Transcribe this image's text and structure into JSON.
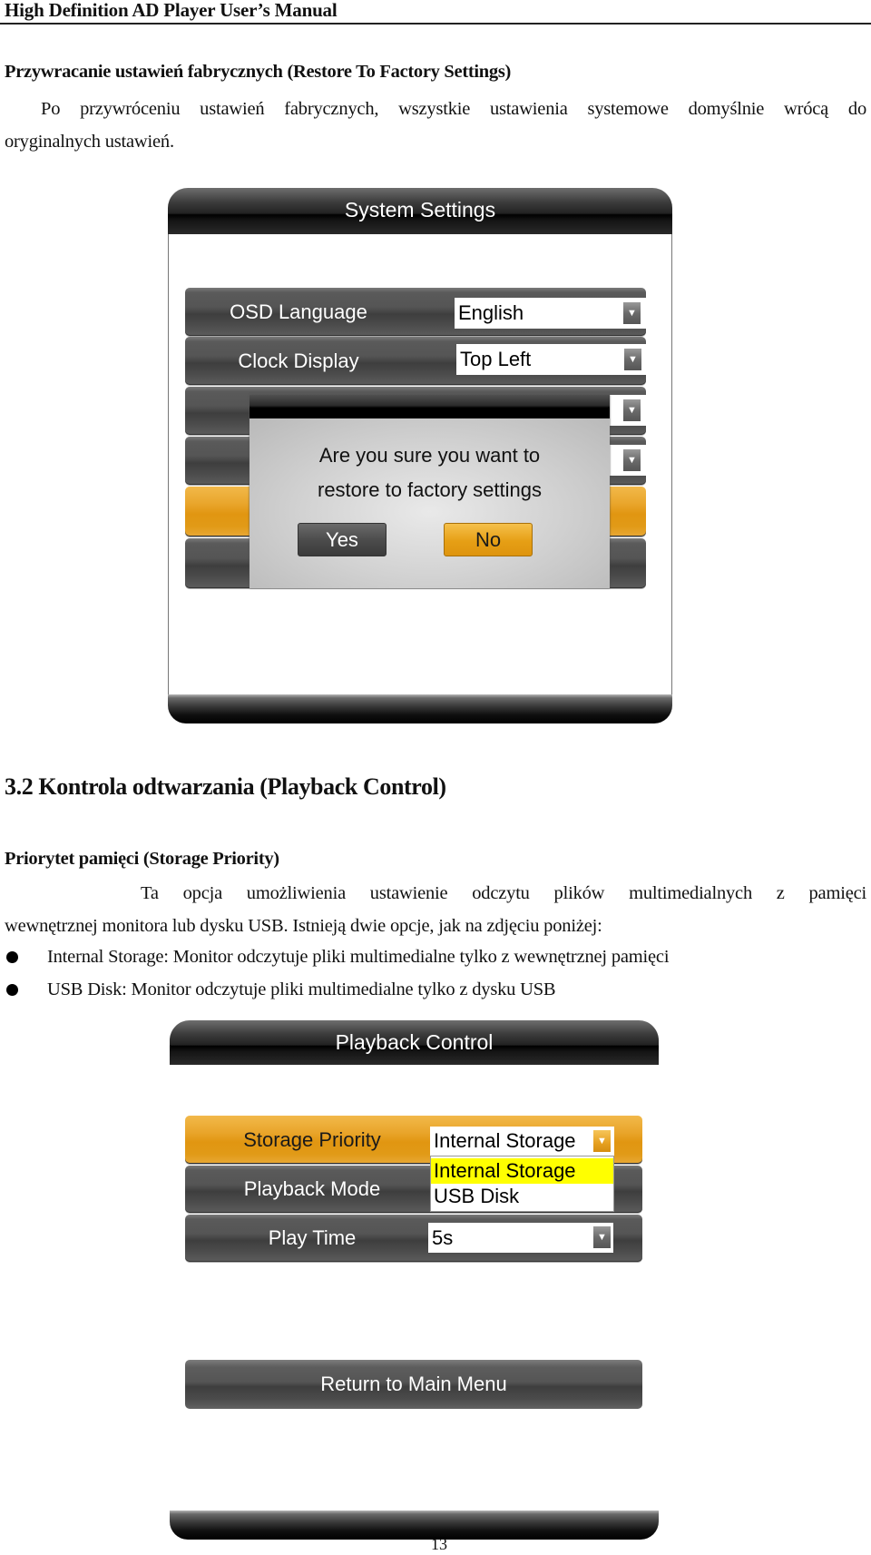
{
  "document": {
    "running_head": "High Definition AD Player User’s Manual",
    "page_number": "13"
  },
  "restore_section": {
    "title": "Przywracanie ustawień fabrycznych (Restore To Factory Settings)",
    "paragraph_line1": "Po przywróceniu ustawień fabrycznych, wszystkie ustawienia systemowe domyślnie wrócą do",
    "paragraph_line2": "oryginalnych ustawień."
  },
  "system_settings_screen": {
    "title": "System Settings",
    "rows": [
      {
        "label": "OSD Language",
        "value": "English"
      },
      {
        "label": "Clock Display",
        "value": "Top Left"
      }
    ],
    "dialog": {
      "message_line1": "Are you sure you want to",
      "message_line2": "restore to factory settings",
      "yes_label": "Yes",
      "no_label": "No",
      "focused_button": "No"
    },
    "colors": {
      "highlight": "#e19611",
      "row": "#4a4a4a"
    }
  },
  "playback_section": {
    "heading": "3.2 Kontrola odtwarzania (Playback Control)",
    "subheading": "Priorytet pamięci (Storage Priority)",
    "paragraph_line1": "Ta opcja umożliwienia ustawienie odczytu plików multimedialnych z pamięci",
    "paragraph_line2": "wewnętrznej monitora lub dysku USB. Istnieją dwie opcje, jak na zdjęciu poniżej:",
    "bullets": [
      "Internal Storage: Monitor odczytuje pliki multimedialne tylko z wewnętrznej pamięci",
      "USB Disk: Monitor odczytuje pliki multimedialne tylko z dysku USB"
    ]
  },
  "playback_control_screen": {
    "title": "Playback Control",
    "rows": [
      {
        "label": "Storage Priority",
        "value": "Internal Storage",
        "active": true
      },
      {
        "label": "Playback Mode",
        "value": ""
      },
      {
        "label": "Play Time",
        "value": "5s"
      }
    ],
    "dropdown_options": [
      "Internal Storage",
      "USB Disk"
    ],
    "dropdown_highlighted": "Internal Storage",
    "return_label": "Return to Main Menu",
    "colors": {
      "dropdown_highlight": "#ffff00",
      "active_row": "#e19611"
    }
  }
}
